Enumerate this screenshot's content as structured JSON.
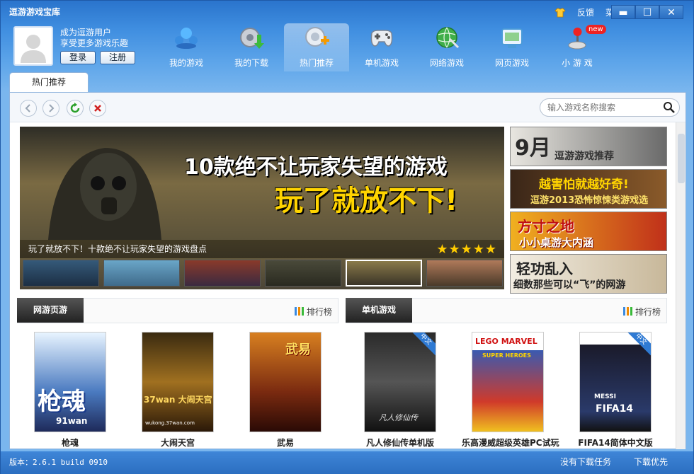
{
  "app": {
    "title": "逗游游戏宝库"
  },
  "topbar": {
    "feedback": "反馈",
    "menu": "菜单",
    "minimize": "▬",
    "maximize": "☐",
    "close": "✕"
  },
  "user": {
    "line1": "成为逗游用户",
    "line2": "享受更多游戏乐趣",
    "login": "登录",
    "register": "注册"
  },
  "nav": [
    {
      "label": "我的游戏",
      "icon": "my-games-icon"
    },
    {
      "label": "我的下载",
      "icon": "download-icon"
    },
    {
      "label": "热门推荐",
      "icon": "hot-recommend-icon"
    },
    {
      "label": "单机游戏",
      "icon": "gamepad-icon"
    },
    {
      "label": "网络游戏",
      "icon": "globe-icon"
    },
    {
      "label": "网页游戏",
      "icon": "web-game-icon"
    },
    {
      "label": "小 游 戏",
      "icon": "joystick-icon",
      "badge": "new"
    }
  ],
  "tab": {
    "label": "热门推荐"
  },
  "search": {
    "placeholder": "输入游戏名称搜索"
  },
  "banner": {
    "headline": "10款绝不让玩家失望的游戏",
    "subheadline": "玩了就放不下!",
    "caption": "玩了就放不下！十款绝不让玩家失望的游戏盘点",
    "stars": "★★★★★"
  },
  "side_ads": [
    {
      "text1": "9月",
      "text2": "逗游游戏推荐"
    },
    {
      "text1": "越害怕就越好奇!",
      "text2": "逗游2013恐怖惊悚类游戏选"
    },
    {
      "text1": "方寸之地",
      "text2": "小小桌游大内涵"
    },
    {
      "text1": "轻功乱入",
      "text2": "细数那些可以“飞”的网游"
    }
  ],
  "panels": {
    "left": {
      "tab": "网游页游",
      "rank": "排行榜"
    },
    "right": {
      "tab": "单机游戏",
      "rank": "排行榜"
    }
  },
  "games": [
    {
      "name": "枪魂",
      "cover_text": "枪魂",
      "cover_sub": "91wan"
    },
    {
      "name": "大闹天宫",
      "cover_text": "37wan 大闹天宫",
      "cover_sub": "wukong.37wan.com"
    },
    {
      "name": "武易",
      "cover_text": "武易",
      "cover_sub": ""
    },
    {
      "name": "凡人修仙传单机版",
      "cover_text": "凡人修仙传",
      "cover_sub": "",
      "corner": "中文"
    },
    {
      "name": "乐高漫威超级英雄PC试玩",
      "cover_text": "LEGO MARVEL",
      "cover_sub": "SUPER HEROES"
    },
    {
      "name": "FIFA14简体中文版",
      "cover_text": "FIFA14",
      "cover_sub": "MESSI",
      "corner": "中文"
    }
  ],
  "status": {
    "version": "版本：2.6.1 build 0910",
    "no_task": "没有下载任务",
    "priority": "下载优先"
  }
}
